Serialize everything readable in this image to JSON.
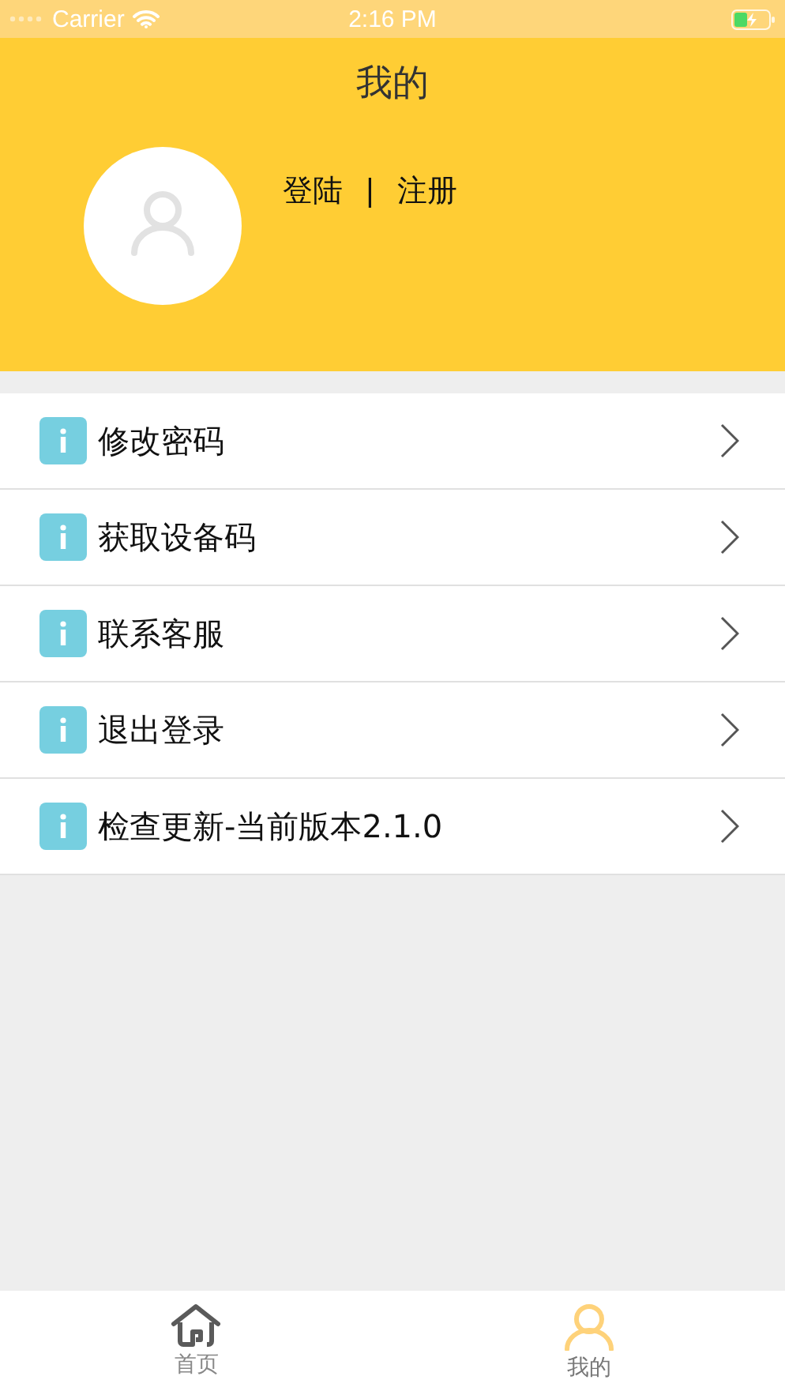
{
  "status_bar": {
    "carrier": "Carrier",
    "time": "2:16 PM"
  },
  "header": {
    "title": "我的",
    "login": "登陆",
    "separator": "|",
    "register": "注册"
  },
  "menu": [
    {
      "label": "修改密码"
    },
    {
      "label": "获取设备码"
    },
    {
      "label": "联系客服"
    },
    {
      "label": "退出登录"
    },
    {
      "label": "检查更新-当前版本2.1.0"
    }
  ],
  "tabs": [
    {
      "label": "首页",
      "kind": "home",
      "selected": false
    },
    {
      "label": "我的",
      "kind": "profile",
      "selected": true
    }
  ]
}
